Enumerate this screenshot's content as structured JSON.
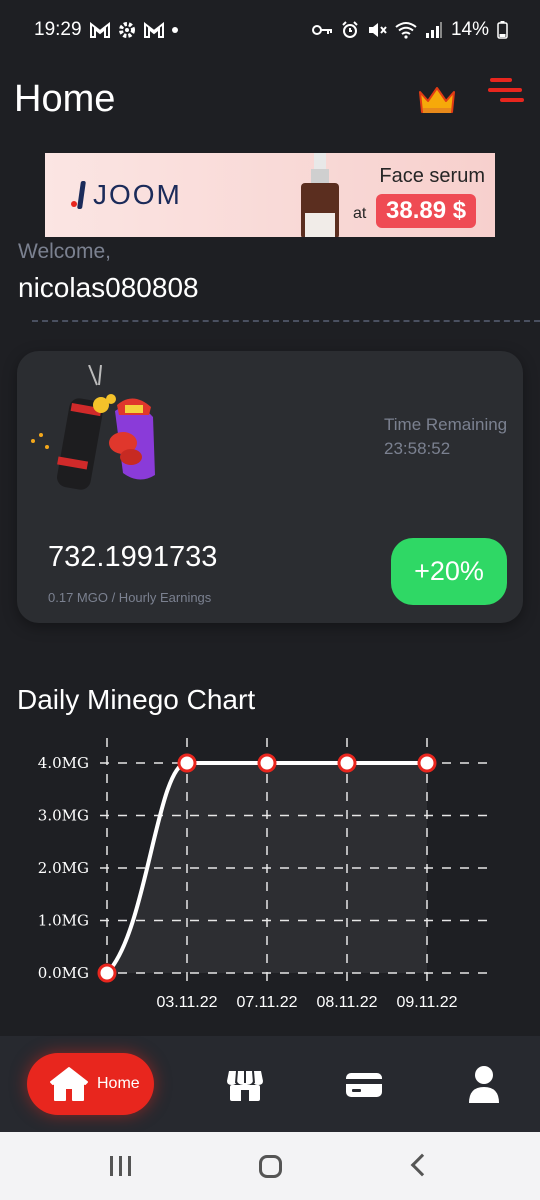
{
  "status_bar": {
    "time": "19:29",
    "battery": "14%",
    "left_icons": [
      "gmail-icon",
      "settings-icon",
      "gmail-icon",
      "dot-icon"
    ],
    "right_icons": [
      "key-icon",
      "alarm-icon",
      "mute-icon",
      "wifi-icon",
      "signal-icon",
      "battery-icon"
    ]
  },
  "header": {
    "title": "Home",
    "crown_icon": "crown-icon",
    "menu_icon": "menu-icon",
    "accent_color": "#e8261e"
  },
  "ad": {
    "brand": "JOOM",
    "product": "Face serum",
    "at": "at",
    "price": "38.89 $"
  },
  "user": {
    "welcome": "Welcome,",
    "username": "nicolas080808"
  },
  "mining_card": {
    "time_remaining_label": "Time Remaining",
    "time_remaining_value": "23:58:52",
    "balance": "732.1991733",
    "earnings": "0.17 MGO / Hourly Earnings",
    "boost": "+20%",
    "boost_color": "#2fd865"
  },
  "chart_section": {
    "title": "Daily Minego Chart"
  },
  "chart_data": {
    "type": "line",
    "x": [
      "",
      "03.11.22",
      "07.11.22",
      "08.11.22",
      "09.11.22"
    ],
    "values": [
      0,
      4,
      4,
      4,
      4
    ],
    "yticks": [
      "0.0MG",
      "1.0MG",
      "2.0MG",
      "3.0MG",
      "4.0MG"
    ],
    "ylim": [
      0,
      4
    ],
    "grid": true
  },
  "bottom_nav": {
    "items": [
      {
        "label": "Home",
        "icon": "home-icon",
        "active": true
      },
      {
        "label": "",
        "icon": "store-icon",
        "active": false
      },
      {
        "label": "",
        "icon": "card-icon",
        "active": false
      },
      {
        "label": "",
        "icon": "user-icon",
        "active": false
      }
    ]
  },
  "system_nav": {
    "recents_icon": "recents-icon",
    "home_icon": "home-button-icon",
    "back_icon": "back-icon"
  }
}
